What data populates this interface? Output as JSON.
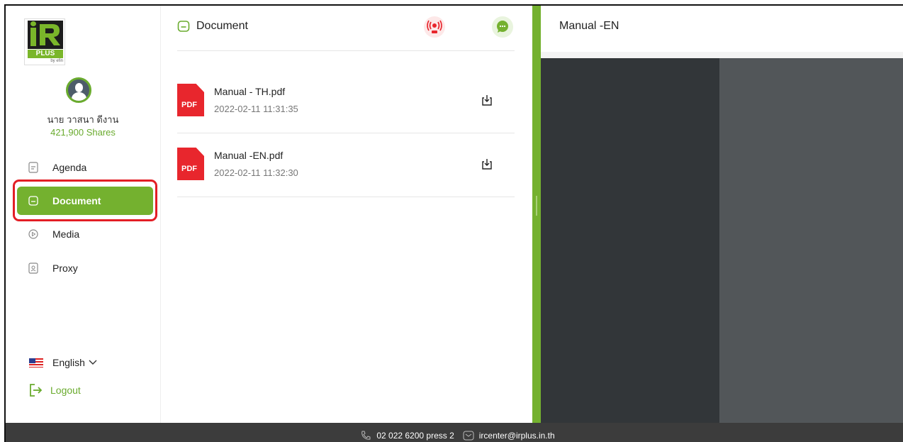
{
  "logo": {
    "main_text": "PLUS",
    "by_text": "by efin"
  },
  "user": {
    "name": "นาย วาสนา ดีงาน",
    "shares": "421,900 Shares"
  },
  "nav": {
    "items": [
      {
        "label": "Agenda",
        "icon": "agenda-icon"
      },
      {
        "label": "Document",
        "icon": "folder-icon",
        "active": true
      },
      {
        "label": "Media",
        "icon": "play-circle-icon"
      },
      {
        "label": "Proxy",
        "icon": "proxy-icon"
      }
    ]
  },
  "language": {
    "label": "English"
  },
  "logout": {
    "label": "Logout"
  },
  "documents": {
    "title": "Document",
    "items": [
      {
        "name": "Manual - TH.pdf",
        "date": "2022-02-11 11:31:35",
        "icon_text": "PDF"
      },
      {
        "name": "Manual -EN.pdf",
        "date": "2022-02-11 11:32:30",
        "icon_text": "PDF"
      }
    ]
  },
  "viewer": {
    "title": "Manual -EN"
  },
  "footer": {
    "phone": "02 022 6200 press 2",
    "email": "ircenter@irplus.in.th"
  },
  "colors": {
    "accent": "#74b12f",
    "highlight": "#e31e25",
    "pdf": "#e8262d",
    "footer_bg": "#3c3c3c",
    "viewer_bg": "#323639"
  }
}
